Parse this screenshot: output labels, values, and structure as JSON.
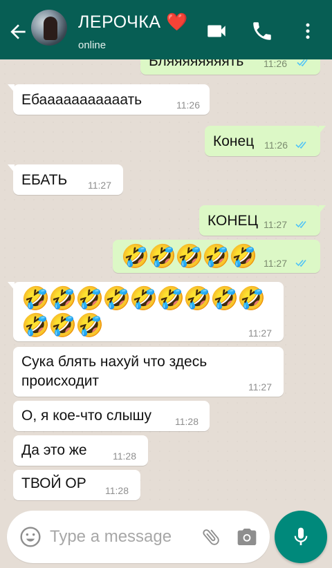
{
  "header": {
    "contact_name": "ЛЕРОЧКА ❤️",
    "status": "online",
    "icons": [
      "back-arrow-icon",
      "video-call-icon",
      "phone-icon",
      "more-vert-icon"
    ]
  },
  "messages": [
    {
      "dir": "out",
      "text": "Бляяяяяяяять",
      "time": "11:26",
      "read": true
    },
    {
      "dir": "in",
      "text": "Ебааааааааааать",
      "time": "11:26"
    },
    {
      "dir": "out",
      "text": "Конец",
      "time": "11:26",
      "read": true
    },
    {
      "dir": "in",
      "text": "ЕБАТЬ",
      "time": "11:27"
    },
    {
      "dir": "out",
      "text": "КОНЕЦ",
      "time": "11:27",
      "read": true
    },
    {
      "dir": "out",
      "emoji": "🤣",
      "count": 5,
      "time": "11:27",
      "read": true
    },
    {
      "dir": "in",
      "emoji": "🤣",
      "count": 12,
      "time": "11:27"
    },
    {
      "dir": "in",
      "line1": "Сука блять нахуй что здесь",
      "line2": "происходит",
      "time": "11:27"
    },
    {
      "dir": "in",
      "text": "О, я кое-что слышу",
      "time": "11:28"
    },
    {
      "dir": "in",
      "text": "Да это же",
      "time": "11:28"
    },
    {
      "dir": "in",
      "text": "ТВОЙ ОР",
      "time": "11:28"
    }
  ],
  "input": {
    "placeholder": "Type a message"
  },
  "colors": {
    "header": "#075e54",
    "outgoing_bubble": "#dcf8c6",
    "incoming_bubble": "#ffffff",
    "read_ticks": "#4fc3f7",
    "mic_button": "#00897b"
  }
}
